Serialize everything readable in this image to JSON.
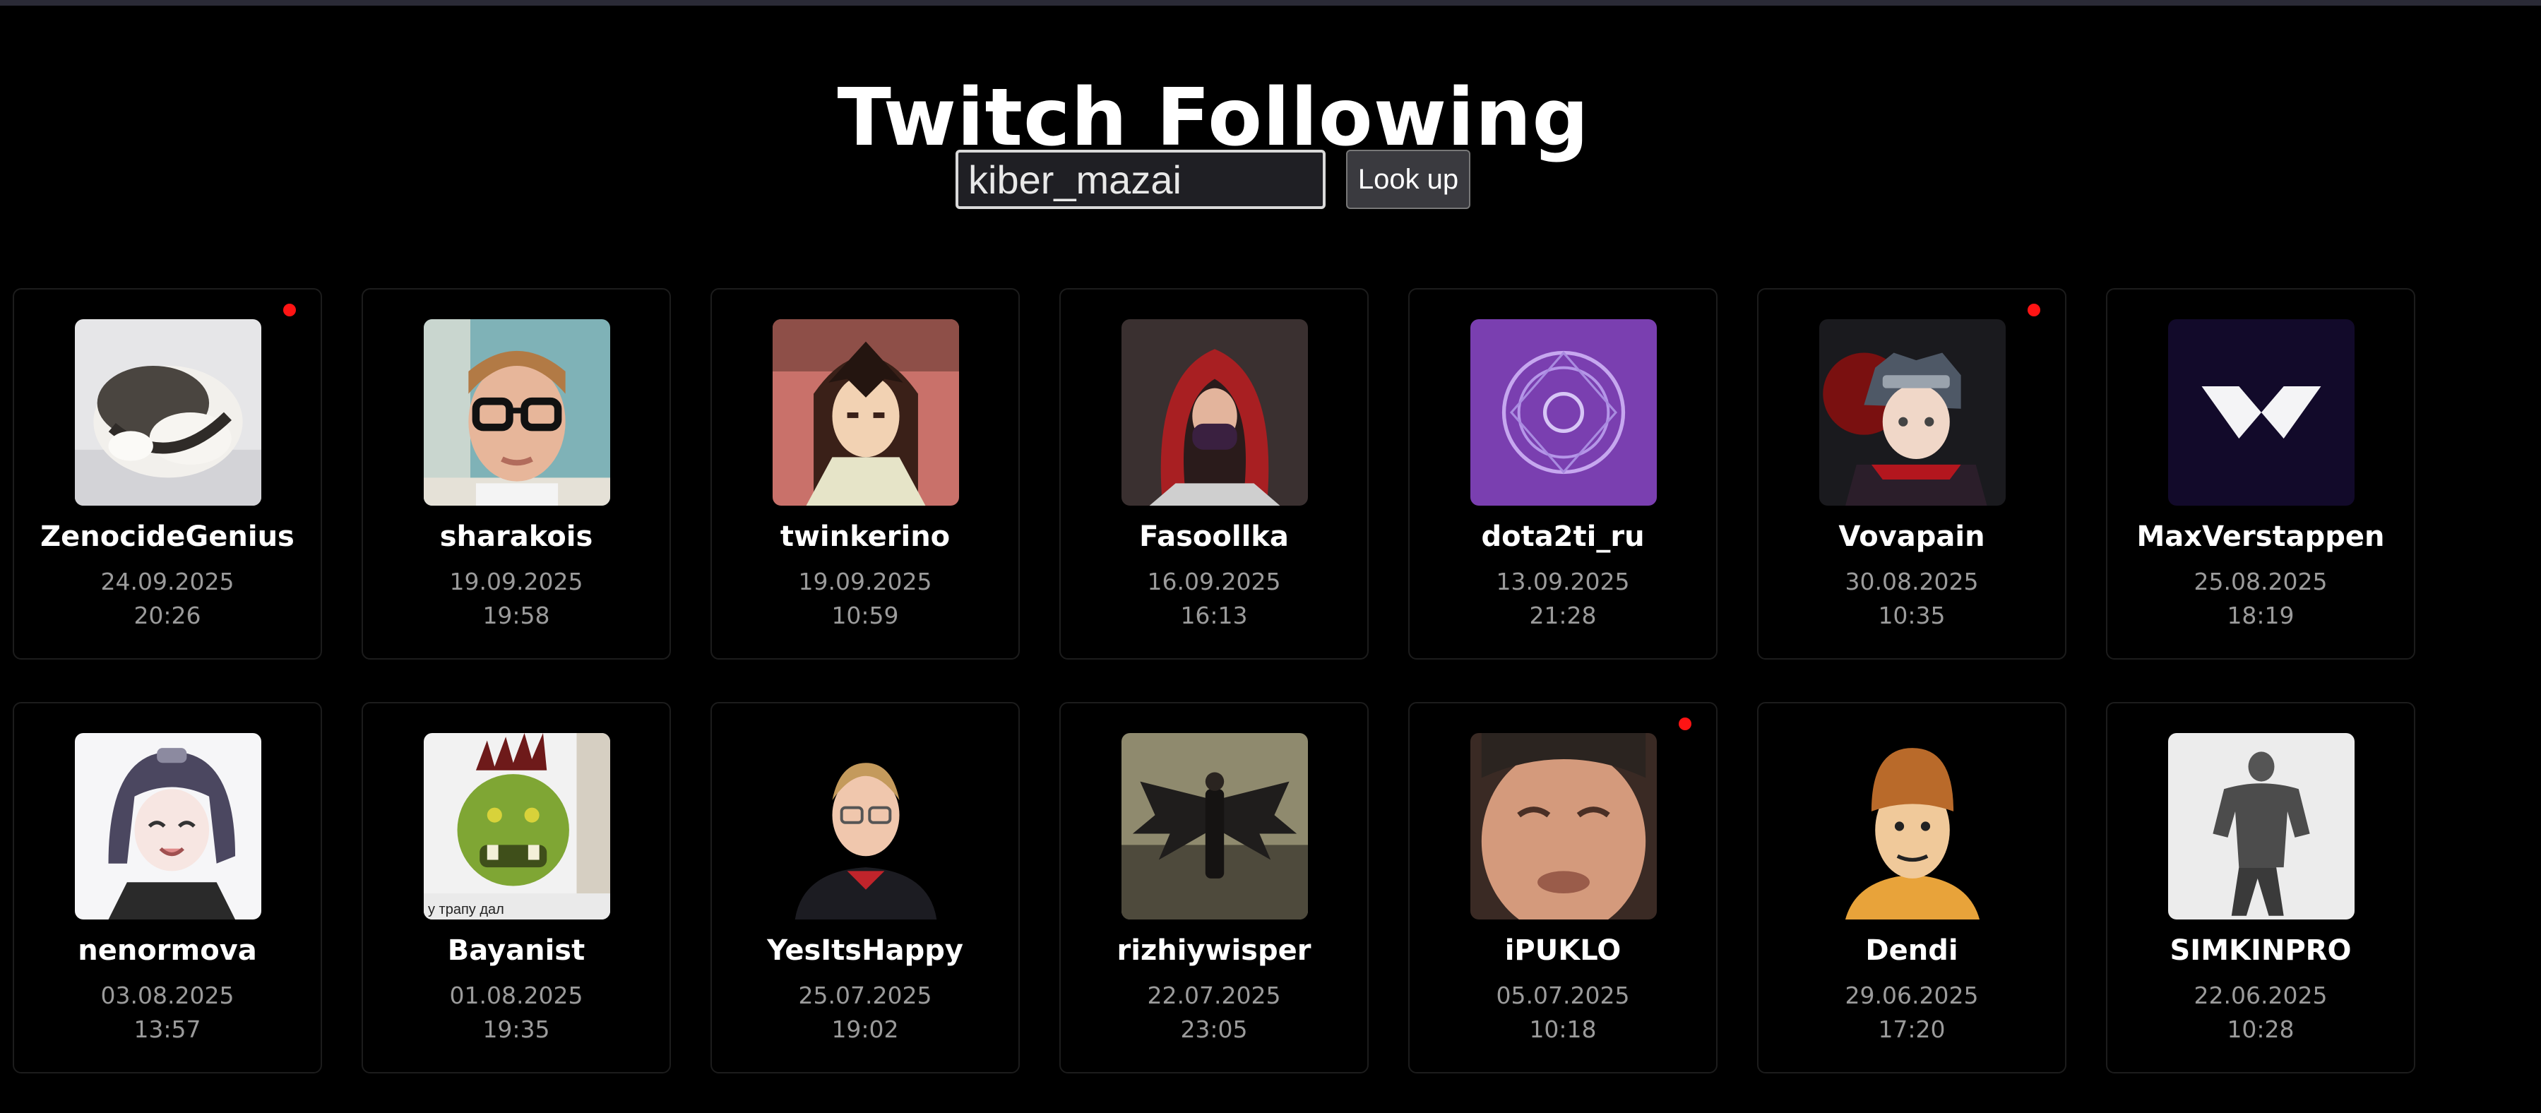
{
  "page": {
    "title": "Twitch Following"
  },
  "search": {
    "value": "kiber_mazai",
    "button_label": "Look up"
  },
  "colors": {
    "background": "#000000",
    "live_indicator": "#ff1414",
    "card_border": "#1c1c1c"
  },
  "channels": [
    {
      "name": "ZenocideGenius",
      "date": "24.09.2025",
      "time": "20:26",
      "live": true,
      "avatar": "cat-avatar"
    },
    {
      "name": "sharakois",
      "date": "19.09.2025",
      "time": "19:58",
      "live": false,
      "avatar": "glasses-man-avatar"
    },
    {
      "name": "twinkerino",
      "date": "19.09.2025",
      "time": "10:59",
      "live": false,
      "avatar": "anime-longhair-avatar"
    },
    {
      "name": "Fasoollka",
      "date": "16.09.2025",
      "time": "16:13",
      "live": false,
      "avatar": "red-hood-avatar"
    },
    {
      "name": "dota2ti_ru",
      "date": "13.09.2025",
      "time": "21:28",
      "live": false,
      "avatar": "purple-emblem-avatar"
    },
    {
      "name": "Vovapain",
      "date": "30.08.2025",
      "time": "10:35",
      "live": true,
      "avatar": "ninja-avatar"
    },
    {
      "name": "MaxVerstappen",
      "date": "25.08.2025",
      "time": "18:19",
      "live": false,
      "avatar": "mv-logo-avatar"
    },
    {
      "name": "nenormova",
      "date": "03.08.2025",
      "time": "13:57",
      "live": false,
      "avatar": "anime-girl-avatar"
    },
    {
      "name": "Bayanist",
      "date": "01.08.2025",
      "time": "19:35",
      "live": false,
      "avatar": "orc-avatar",
      "avatar_caption": "у трапу дал"
    },
    {
      "name": "YesItsHappy",
      "date": "25.07.2025",
      "time": "19:02",
      "live": false,
      "avatar": "young-man-avatar"
    },
    {
      "name": "rizhiywisper",
      "date": "22.07.2025",
      "time": "23:05",
      "live": false,
      "avatar": "dark-angel-avatar"
    },
    {
      "name": "iPUKLO",
      "date": "05.07.2025",
      "time": "10:18",
      "live": true,
      "avatar": "grimace-face-avatar"
    },
    {
      "name": "Dendi",
      "date": "29.06.2025",
      "time": "17:20",
      "live": false,
      "avatar": "cartoon-dendi-avatar"
    },
    {
      "name": "SIMKINPRO",
      "date": "22.06.2025",
      "time": "10:28",
      "live": false,
      "avatar": "bodybuilder-avatar"
    }
  ]
}
